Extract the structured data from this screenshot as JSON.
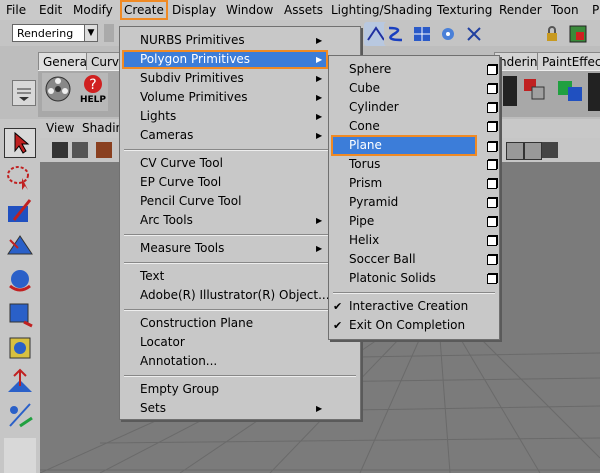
{
  "menubar": {
    "items": [
      "File",
      "Edit",
      "Modify",
      "Create",
      "Display",
      "Window",
      "Assets",
      "Lighting/Shading",
      "Texturing",
      "Render",
      "Toon",
      "P"
    ]
  },
  "toolbar": {
    "mode_select": "Rendering",
    "tabs": [
      "General",
      "Curve",
      "ndering",
      "PaintEffects"
    ],
    "help_label": "HELP"
  },
  "viewpanel": {
    "menu": [
      "View",
      "Shadin"
    ]
  },
  "create_menu": {
    "items": [
      {
        "label": "NURBS Primitives",
        "submenu": true
      },
      {
        "label": "Polygon Primitives",
        "submenu": true
      },
      {
        "label": "Subdiv Primitives",
        "submenu": true
      },
      {
        "label": "Volume Primitives",
        "submenu": true
      },
      {
        "label": "Lights",
        "submenu": true
      },
      {
        "label": "Cameras",
        "submenu": true
      },
      {
        "label": "CV Curve Tool"
      },
      {
        "label": "EP Curve Tool"
      },
      {
        "label": "Pencil Curve Tool"
      },
      {
        "label": "Arc Tools",
        "submenu": true
      },
      {
        "label": "Measure Tools",
        "submenu": true
      },
      {
        "label": "Text"
      },
      {
        "label": "Adobe(R) Illustrator(R) Object..."
      },
      {
        "label": "Construction Plane"
      },
      {
        "label": "Locator"
      },
      {
        "label": "Annotation..."
      },
      {
        "label": "Empty Group"
      },
      {
        "label": "Sets",
        "submenu": true
      }
    ]
  },
  "polygon_menu": {
    "items": [
      "Sphere",
      "Cube",
      "Cylinder",
      "Cone",
      "Plane",
      "Torus",
      "Prism",
      "Pyramid",
      "Pipe",
      "Helix",
      "Soccer Ball",
      "Platonic Solids"
    ],
    "checks": [
      "Interactive Creation",
      "Exit On Completion"
    ],
    "check_mark": "✔"
  }
}
